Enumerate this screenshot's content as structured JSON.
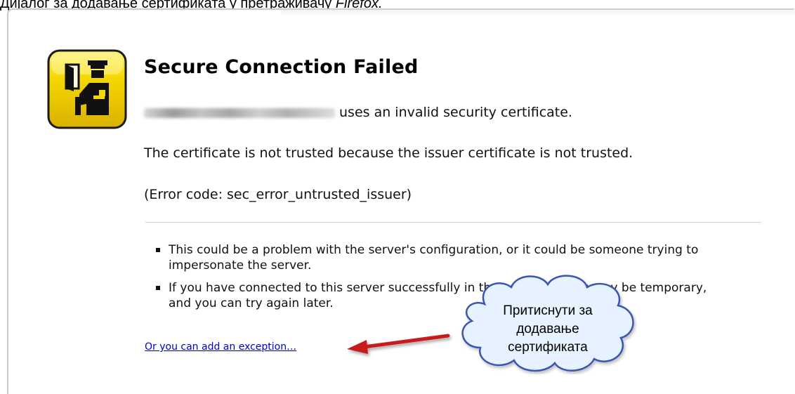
{
  "caption": {
    "text": "Дијалог за додавање сертификата у претраживачу ",
    "em": "Firefox."
  },
  "dialog": {
    "title": "Secure Connection Failed",
    "line1_suffix": "uses an invalid security certificate.",
    "line2": "The certificate is not trusted because the issuer certificate is not trusted.",
    "line3": "(Error code: sec_error_untrusted_issuer)",
    "bullets": [
      "This could be a problem with the server's configuration, or it could be someone trying to impersonate the server.",
      "If you have connected to this server successfully in the past, the error may be temporary, and you can try again later."
    ],
    "exception_link": "Or you can add an exception…"
  },
  "callout": {
    "line1": "Притиснути за",
    "line2": "додавање",
    "line3": "сертификата"
  },
  "colors": {
    "icon_yellow": "#f2d200",
    "link_blue": "#0000cc",
    "arrow_red": "#c81e1e",
    "cloud_fill": "#e6f2ff",
    "cloud_stroke": "#3a55b0"
  },
  "icons": {
    "policeman": "security-officer-icon",
    "arrow": "arrow-left-icon",
    "cloud": "cloud-callout-icon"
  }
}
